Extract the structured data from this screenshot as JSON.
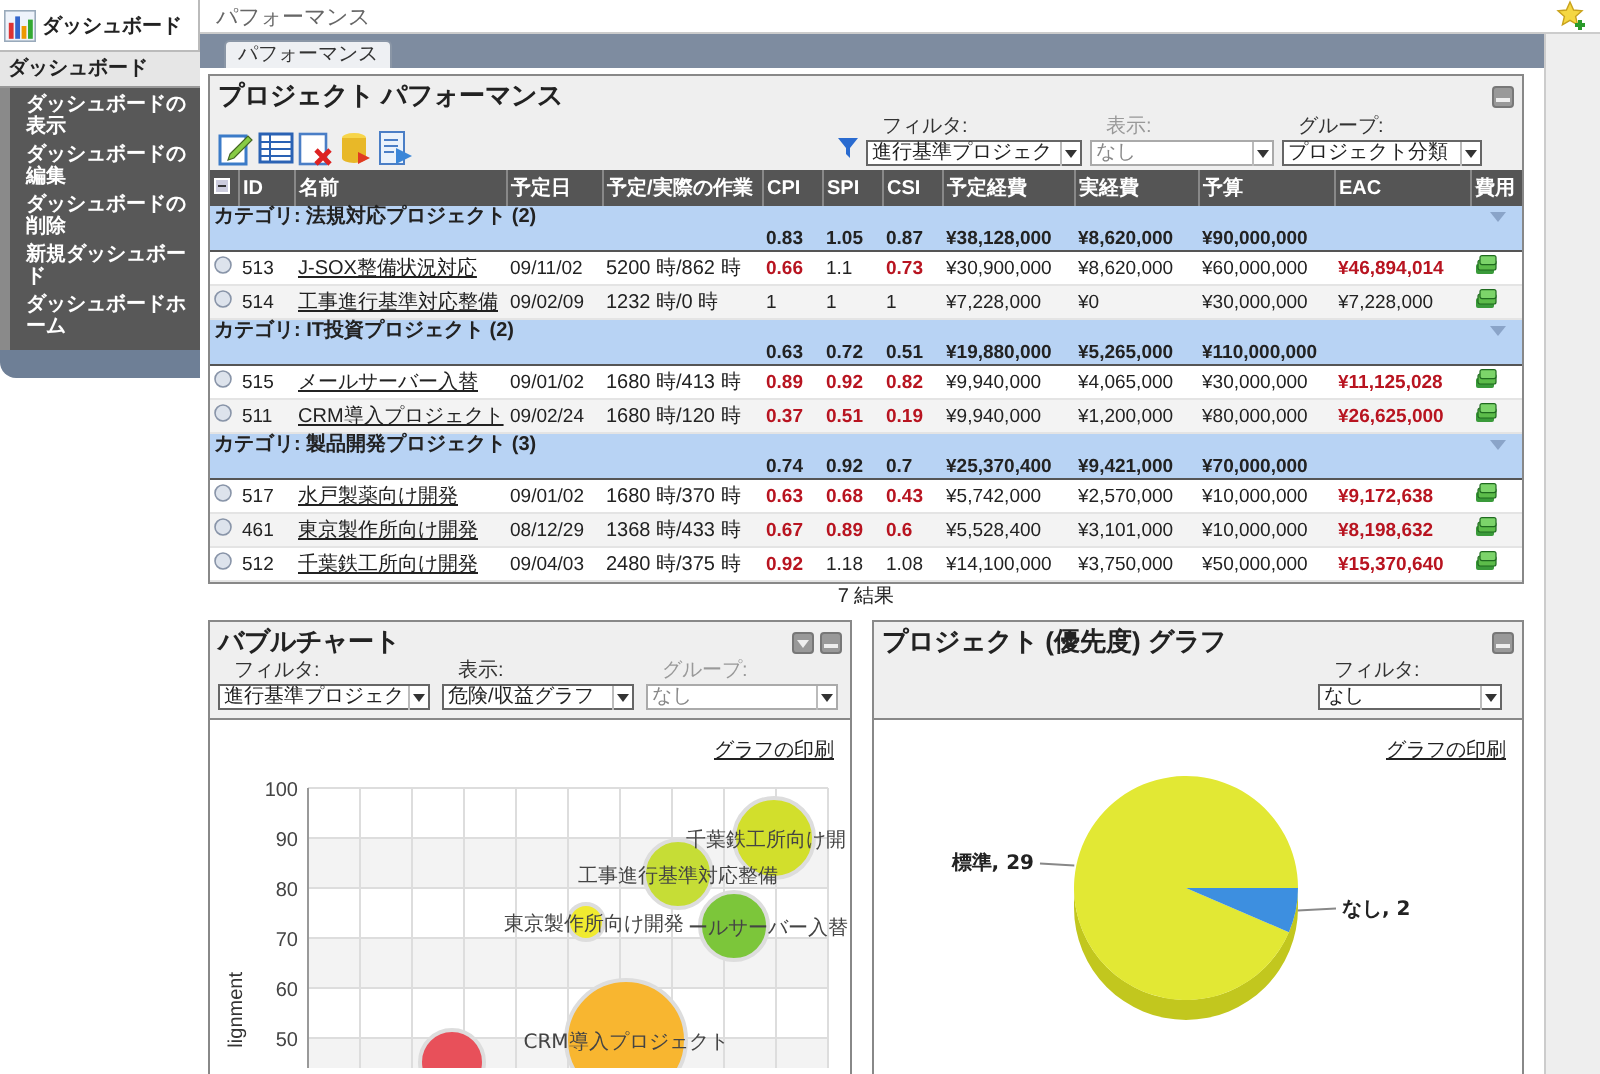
{
  "header": {
    "title": "パフォーマンス"
  },
  "sidebar": {
    "title": "ダッシュボード",
    "section": "ダッシュボード",
    "items": [
      {
        "label": "ダッシュボードの表示"
      },
      {
        "label": "ダッシュボードの編集"
      },
      {
        "label": "ダッシュボードの削除"
      },
      {
        "label": "新規ダッシュボード"
      },
      {
        "label": "ダッシュボードホーム"
      }
    ]
  },
  "tabs": [
    {
      "label": "パフォーマンス",
      "selected": true
    }
  ],
  "performance": {
    "title": "プロジェクト パフォーマンス",
    "filters": [
      {
        "label": "フィルタ:",
        "value": "進行基準プロジェク",
        "disabled": false
      },
      {
        "label": "表示:",
        "value": "なし",
        "disabled": true
      },
      {
        "label": "グループ:",
        "value": "プロジェクト分類",
        "disabled": false
      }
    ],
    "columns": [
      "ID",
      "名前",
      "予定日",
      "予定/実際の作業",
      "CPI",
      "SPI",
      "CSI",
      "予定経費",
      "実経費",
      "予算",
      "EAC",
      "費用"
    ],
    "groups": [
      {
        "name": "カテゴリ: 法規対応プロジェクト (2)",
        "cpi": "0.83",
        "spi": "1.05",
        "csi": "0.87",
        "planned": "¥38,128,000",
        "actual": "¥8,620,000",
        "budget": "¥90,000,000",
        "rows": [
          {
            "id": "513",
            "name": "J-SOX整備状況対応",
            "date": "09/11/02",
            "work": "5200 時/862 時",
            "cpi": "0.66",
            "cpi_alert": true,
            "spi": "1.1",
            "spi_alert": false,
            "csi": "0.73",
            "csi_alert": true,
            "planned": "¥30,900,000",
            "actual": "¥8,620,000",
            "budget": "¥60,000,000",
            "eac": "¥46,894,014",
            "eac_alert": true
          },
          {
            "id": "514",
            "name": "工事進行基準対応整備",
            "date": "09/02/09",
            "work": "1232 時/0 時",
            "cpi": "1",
            "cpi_alert": false,
            "spi": "1",
            "spi_alert": false,
            "csi": "1",
            "csi_alert": false,
            "planned": "¥7,228,000",
            "actual": "¥0",
            "budget": "¥30,000,000",
            "eac": "¥7,228,000",
            "eac_alert": false
          }
        ]
      },
      {
        "name": "カテゴリ: IT投資プロジェクト (2)",
        "cpi": "0.63",
        "spi": "0.72",
        "csi": "0.51",
        "planned": "¥19,880,000",
        "actual": "¥5,265,000",
        "budget": "¥110,000,000",
        "rows": [
          {
            "id": "515",
            "name": "メールサーバー入替",
            "date": "09/01/02",
            "work": "1680 時/413 時",
            "cpi": "0.89",
            "cpi_alert": true,
            "spi": "0.92",
            "spi_alert": true,
            "csi": "0.82",
            "csi_alert": true,
            "planned": "¥9,940,000",
            "actual": "¥4,065,000",
            "budget": "¥30,000,000",
            "eac": "¥11,125,028",
            "eac_alert": true
          },
          {
            "id": "511",
            "name": "CRM導入プロジェクト",
            "date": "09/02/24",
            "work": "1680 時/120 時",
            "cpi": "0.37",
            "cpi_alert": true,
            "spi": "0.51",
            "spi_alert": true,
            "csi": "0.19",
            "csi_alert": true,
            "planned": "¥9,940,000",
            "actual": "¥1,200,000",
            "budget": "¥80,000,000",
            "eac": "¥26,625,000",
            "eac_alert": true
          }
        ]
      },
      {
        "name": "カテゴリ: 製品開発プロジェクト (3)",
        "cpi": "0.74",
        "spi": "0.92",
        "csi": "0.7",
        "planned": "¥25,370,400",
        "actual": "¥9,421,000",
        "budget": "¥70,000,000",
        "rows": [
          {
            "id": "517",
            "name": "水戸製薬向け開発",
            "date": "09/01/02",
            "work": "1680 時/370 時",
            "cpi": "0.63",
            "cpi_alert": true,
            "spi": "0.68",
            "spi_alert": true,
            "csi": "0.43",
            "csi_alert": true,
            "planned": "¥5,742,000",
            "actual": "¥2,570,000",
            "budget": "¥10,000,000",
            "eac": "¥9,172,638",
            "eac_alert": true
          },
          {
            "id": "461",
            "name": "東京製作所向け開発",
            "date": "08/12/29",
            "work": "1368 時/433 時",
            "cpi": "0.67",
            "cpi_alert": true,
            "spi": "0.89",
            "spi_alert": true,
            "csi": "0.6",
            "csi_alert": true,
            "planned": "¥5,528,400",
            "actual": "¥3,101,000",
            "budget": "¥10,000,000",
            "eac": "¥8,198,632",
            "eac_alert": true
          },
          {
            "id": "512",
            "name": "千葉鉄工所向け開発",
            "date": "09/04/03",
            "work": "2480 時/375 時",
            "cpi": "0.92",
            "cpi_alert": true,
            "spi": "1.18",
            "spi_alert": false,
            "csi": "1.08",
            "csi_alert": false,
            "planned": "¥14,100,000",
            "actual": "¥3,750,000",
            "budget": "¥50,000,000",
            "eac": "¥15,370,640",
            "eac_alert": true
          }
        ]
      }
    ],
    "result_count": "7 結果"
  },
  "bubble_panel": {
    "title": "バブルチャート",
    "filters": [
      {
        "label": "フィルタ:",
        "value": "進行基準プロジェク",
        "disabled": false
      },
      {
        "label": "表示:",
        "value": "危険/収益グラフ",
        "disabled": false
      },
      {
        "label": "グループ:",
        "value": "なし",
        "disabled": true
      }
    ],
    "print_link": "グラフの印刷",
    "bubble_chart": {
      "y_axis_label": "lignment",
      "y_ticks": [
        "100",
        "90",
        "80",
        "70",
        "60",
        "50"
      ],
      "bubbles": [
        {
          "label": "千葉鉄工所向け開",
          "color": "#d2df2c"
        },
        {
          "label": "工事進行基準対応整備",
          "color": "#c6dd36"
        },
        {
          "label": "東京製作所向け開発",
          "color": "#f0ea30"
        },
        {
          "label": "ールサーバー入替",
          "color": "#7cc63a"
        },
        {
          "label": "CRM導入プロジェクト",
          "color": "#f8b630"
        },
        {
          "color": "#e8505a"
        }
      ]
    }
  },
  "priority_panel": {
    "title": "プロジェクト (優先度) グラフ",
    "filters": [
      {
        "label": "フィルタ:",
        "value": "なし",
        "disabled": false
      }
    ],
    "print_link": "グラフの印刷",
    "chart_data": {
      "type": "pie",
      "values": [
        29,
        2
      ],
      "value_labels": [
        "標準, 29",
        "なし, 2"
      ]
    }
  }
}
